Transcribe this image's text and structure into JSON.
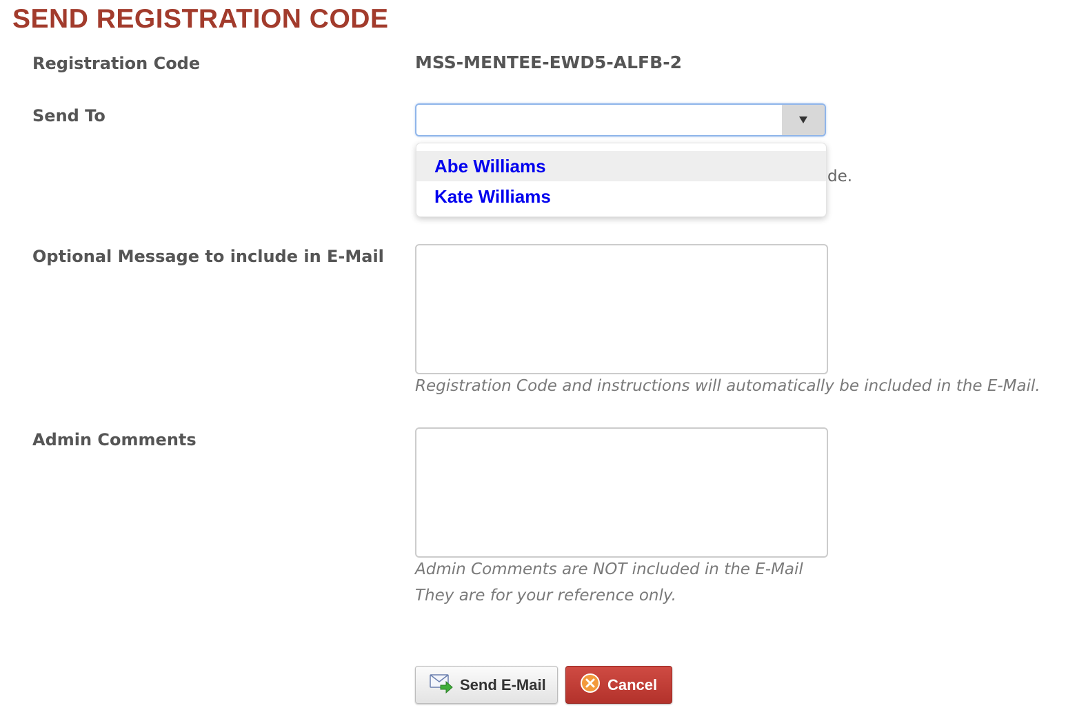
{
  "page": {
    "title": "SEND REGISTRATION CODE"
  },
  "form": {
    "registration_code": {
      "label": "Registration Code",
      "value": "MSS-MENTEE-EWD5-ALFB-2"
    },
    "send_to": {
      "label": "Send To",
      "selected_value": "",
      "hidden_hint_fragment": "de.",
      "options": [
        "Abe Williams",
        "Kate Williams"
      ],
      "highlighted_option_index": 0
    },
    "optional_message": {
      "label": "Optional Message to include in E-Mail",
      "value": "",
      "help": "Registration Code and instructions will automatically be included in the E-Mail."
    },
    "admin_comments": {
      "label": "Admin Comments",
      "value": "",
      "help_line1": "Admin Comments are NOT included in the E-Mail",
      "help_line2": "They are for your reference only."
    }
  },
  "buttons": {
    "send_label": "Send E-Mail",
    "cancel_label": "Cancel"
  },
  "colors": {
    "title": "#a23b2c",
    "option_link": "#0000ee",
    "cancel_button": "#c0392b"
  },
  "icons": {
    "send": "email-send-icon",
    "cancel": "cancel-x-icon",
    "dropdown": "triangle-down-icon"
  }
}
